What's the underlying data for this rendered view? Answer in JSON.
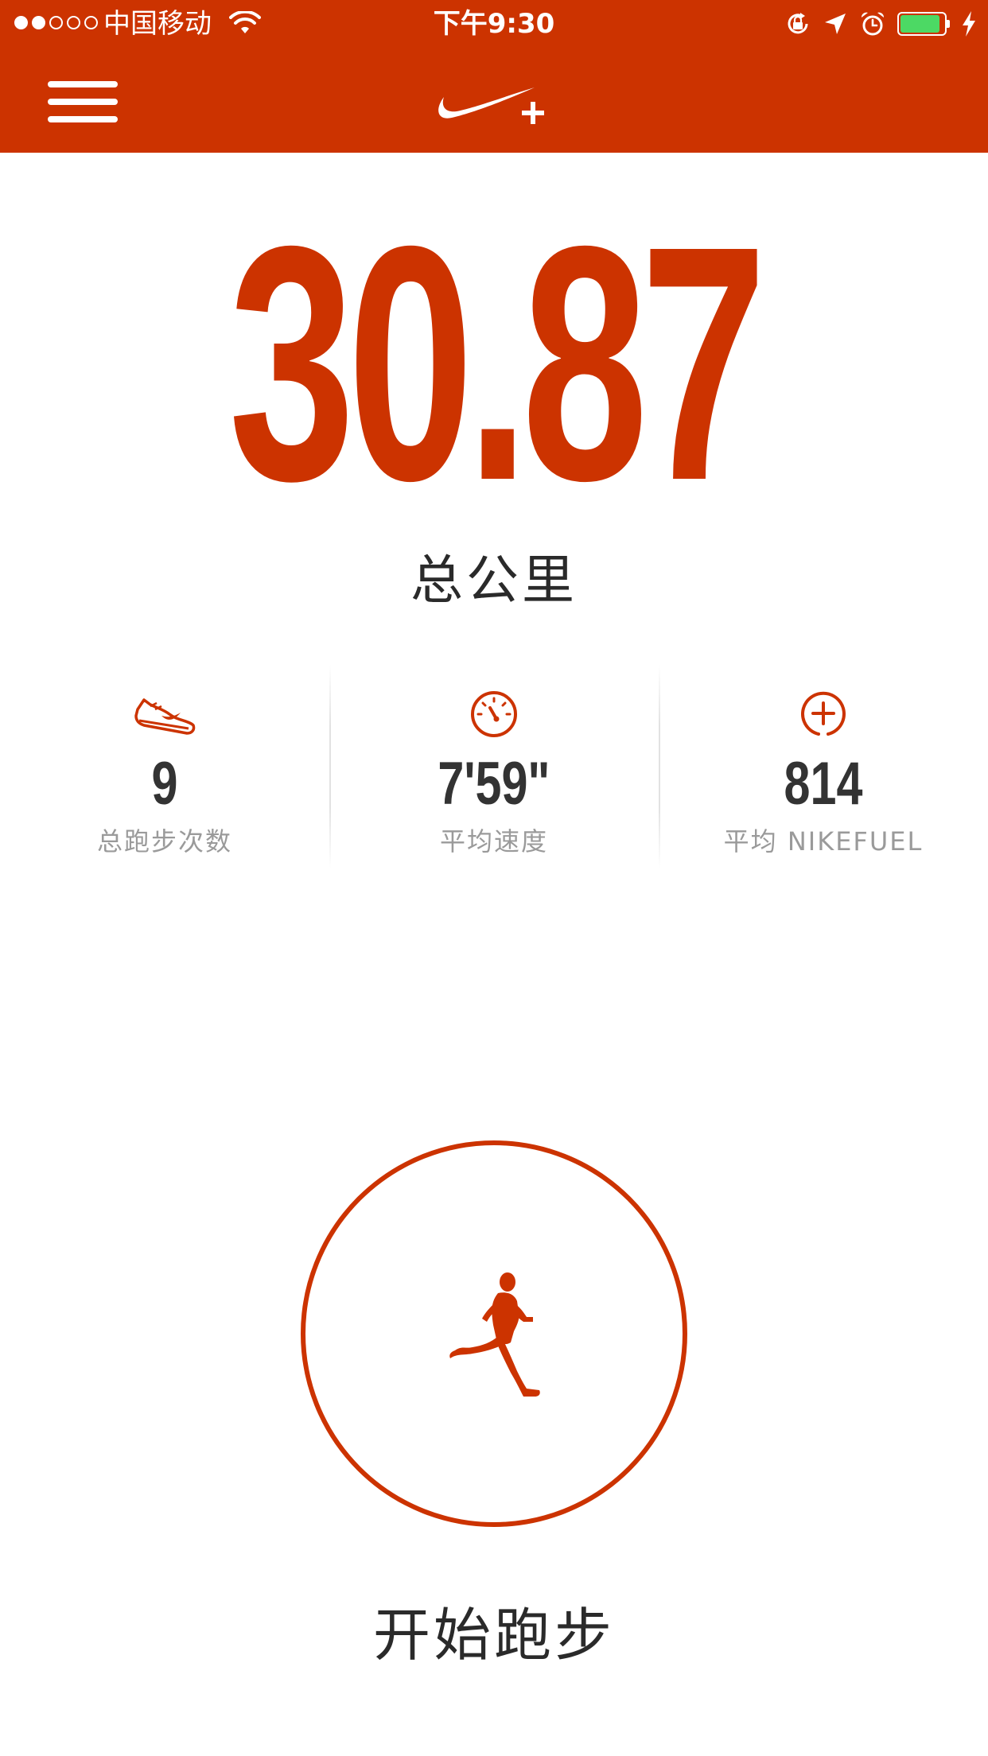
{
  "status_bar": {
    "signal_bars_filled": 2,
    "signal_bars_total": 5,
    "carrier": "中国移动",
    "time": "下午9:30",
    "battery_level": 0.9,
    "icons": [
      "wifi-icon",
      "rotation-lock-icon",
      "location-arrow-icon",
      "alarm-clock-icon",
      "battery-icon",
      "charging-bolt-icon"
    ]
  },
  "header": {
    "menu_icon": "hamburger-menu-icon",
    "logo": "nike-plus-logo"
  },
  "summary": {
    "total_distance": "30.87",
    "total_distance_label": "总公里"
  },
  "stats": [
    {
      "icon": "running-shoe-icon",
      "value": "9",
      "label": "总跑步次数"
    },
    {
      "icon": "speedometer-icon",
      "value": "7'59\"",
      "label": "平均速度"
    },
    {
      "icon": "nikefuel-plus-icon",
      "value": "814",
      "label": "平均 NIKEFUEL"
    }
  ],
  "start": {
    "icon": "runner-icon",
    "label": "开始跑步"
  },
  "colors": {
    "brand_orange": "#cc3300",
    "battery_green": "#4cd964",
    "text_dark": "#333333",
    "text_muted": "#9a9a9a"
  }
}
